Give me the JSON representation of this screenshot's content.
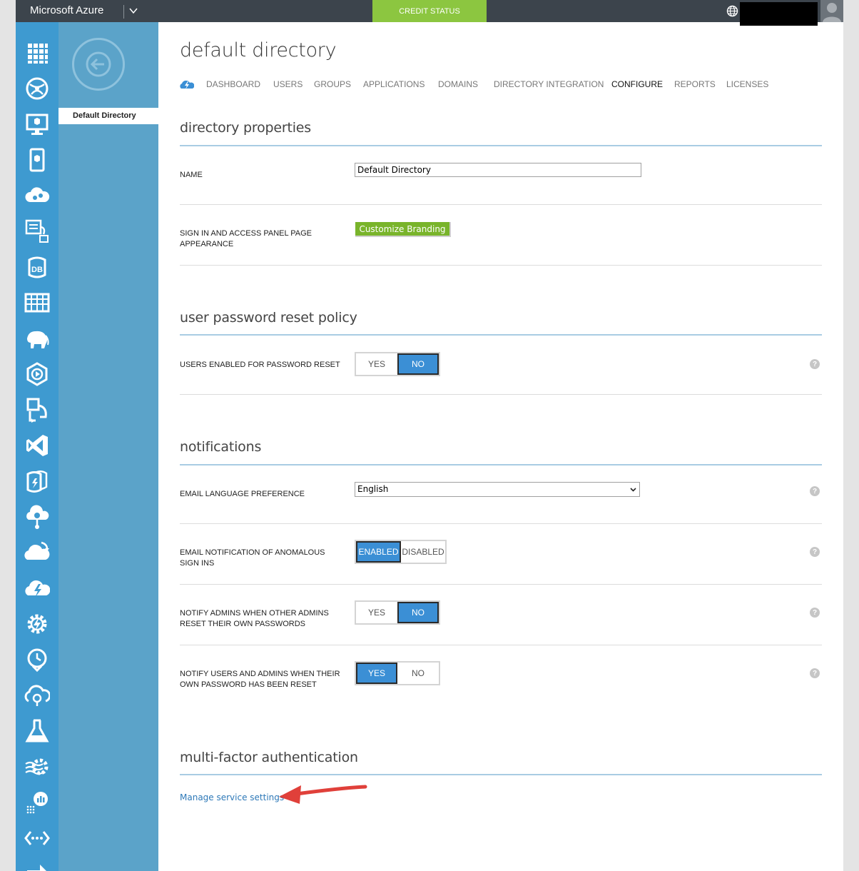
{
  "topbar": {
    "brand": "Microsoft Azure",
    "credit_status": "CREDIT STATUS"
  },
  "rail": {
    "icons": [
      "all-items-icon",
      "web-sites-icon",
      "virtual-machines-icon",
      "mobile-services-icon",
      "cloud-services-icon",
      "batch-services-icon",
      "sql-databases-icon",
      "storage-icon",
      "hdinsight-icon",
      "media-services-icon",
      "service-bus-icon",
      "visual-studio-online-icon",
      "cache-icon",
      "biztalk-services-icon",
      "recovery-services-icon",
      "cdn-icon",
      "automation-icon",
      "scheduler-icon",
      "api-management-icon",
      "machine-learning-icon",
      "stream-analytics-icon",
      "operational-insights-icon",
      "networks-icon",
      "traffic-manager-icon"
    ],
    "accent_color": "#3e9ad0"
  },
  "subnav": {
    "items": [
      {
        "label": "Default Directory"
      }
    ]
  },
  "page": {
    "title": "default directory",
    "tabs": [
      {
        "label": "DASHBOARD"
      },
      {
        "label": "USERS"
      },
      {
        "label": "GROUPS"
      },
      {
        "label": "APPLICATIONS"
      },
      {
        "label": "DOMAINS"
      },
      {
        "label": "DIRECTORY INTEGRATION"
      },
      {
        "label": "CONFIGURE"
      },
      {
        "label": "REPORTS"
      },
      {
        "label": "LICENSES"
      }
    ],
    "active_tab": "CONFIGURE"
  },
  "sections": {
    "directory_properties": {
      "title": "directory properties",
      "name_label": "NAME",
      "name_value": "Default Directory",
      "appearance_label": "SIGN IN AND ACCESS PANEL PAGE APPEARANCE",
      "branding_button": "Customize Branding"
    },
    "password_reset": {
      "title": "user password reset policy",
      "users_enabled_label": "USERS ENABLED FOR PASSWORD RESET",
      "yes": "YES",
      "no": "NO",
      "selected": "NO"
    },
    "notifications": {
      "title": "notifications",
      "language_label": "EMAIL LANGUAGE PREFERENCE",
      "language_value": "English",
      "anomalous_label": "EMAIL NOTIFICATION OF ANOMALOUS SIGN INS",
      "enabled": "ENABLED",
      "disabled": "DISABLED",
      "anomalous_selected": "ENABLED",
      "notify_admins_label": "NOTIFY ADMINS WHEN OTHER ADMINS RESET THEIR OWN PASSWORDS",
      "notify_admins_selected": "NO",
      "notify_users_label": "NOTIFY USERS AND ADMINS WHEN THEIR OWN PASSWORD HAS BEEN RESET",
      "notify_users_selected": "YES",
      "yes": "YES",
      "no": "NO",
      "help": "?"
    },
    "mfa": {
      "title": "multi-factor authentication",
      "manage_link": "Manage service settings"
    }
  },
  "colors": {
    "topbar": "#3c444c",
    "credit": "#8cc640",
    "toggle_on": "#3b8fd5",
    "branding_button": "#79b42b",
    "link": "#2e79b8",
    "annotation_arrow": "#e0403a"
  }
}
